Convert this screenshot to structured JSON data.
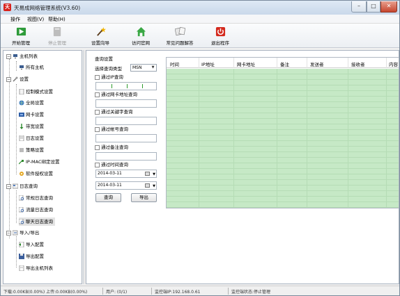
{
  "window": {
    "title": "天易成网络管理系统(V3.60)",
    "app_icon_glyph": "天",
    "controls": {
      "minimize": "–",
      "maximize": "□",
      "close": "✕"
    }
  },
  "menu": [
    "操作",
    "视图(V)",
    "帮助(H)"
  ],
  "toolbar": [
    {
      "label": "开始管理",
      "icon": "start-manage-icon",
      "enabled": true
    },
    {
      "label": "停止管理",
      "icon": "stop-manage-icon",
      "enabled": false
    },
    {
      "label": "设置向导",
      "icon": "wizard-wand-icon",
      "enabled": true
    },
    {
      "label": "访问官网",
      "icon": "home-icon",
      "enabled": true
    },
    {
      "label": "常见问题解答",
      "icon": "faq-icon",
      "enabled": true
    },
    {
      "label": "退出程序",
      "icon": "power-icon",
      "enabled": true
    }
  ],
  "tree": {
    "host_list": {
      "label": "主机列表",
      "children": [
        "所有主机"
      ]
    },
    "settings": {
      "label": "设置",
      "children": [
        "控制模式设置",
        "全局设置",
        "网卡设置",
        "带宽设置",
        "日志设置",
        "策略设置",
        "IP-MAC绑定设置",
        "软件授权设置"
      ]
    },
    "log_query": {
      "label": "日志查询",
      "children": [
        "常规日志查询",
        "流量日志查询",
        "聊天日志查询"
      ]
    },
    "import_export": {
      "label": "导入/导出",
      "children": [
        "导入配置",
        "导出配置",
        "导出主机列表"
      ]
    }
  },
  "query": {
    "title": "查询设置",
    "type_label": "选择查询类型",
    "type_value": "MSN",
    "by_ip": "通过IP查询",
    "by_mac": "通过网卡地址查询",
    "by_keyword": "通过关键字查询",
    "by_account": "通过帐号查询",
    "by_note": "通过备注查询",
    "by_time": "通过时间查询",
    "date_from": "2014-03-11",
    "date_to": "2014-03-11",
    "query_button": "查询",
    "export_button": "导出"
  },
  "grid": {
    "columns": [
      "时间",
      "IP地址",
      "网卡地址",
      "备注",
      "发送者",
      "接收者",
      "内容"
    ]
  },
  "status": {
    "transfer": "下载:0.00KB(0.00%) 上传:0.00KB(0.00%)",
    "users": "用户: (0/1)",
    "monitor_ip": "监控端IP:192.168.0.61",
    "monitor_state": "监控端状态:停止管理"
  },
  "colors": {
    "grid_fill": "#c6e9c6",
    "close_button": "#c6452d",
    "power_icon": "#d42a1e",
    "start_icon": "#2e9b3a"
  }
}
